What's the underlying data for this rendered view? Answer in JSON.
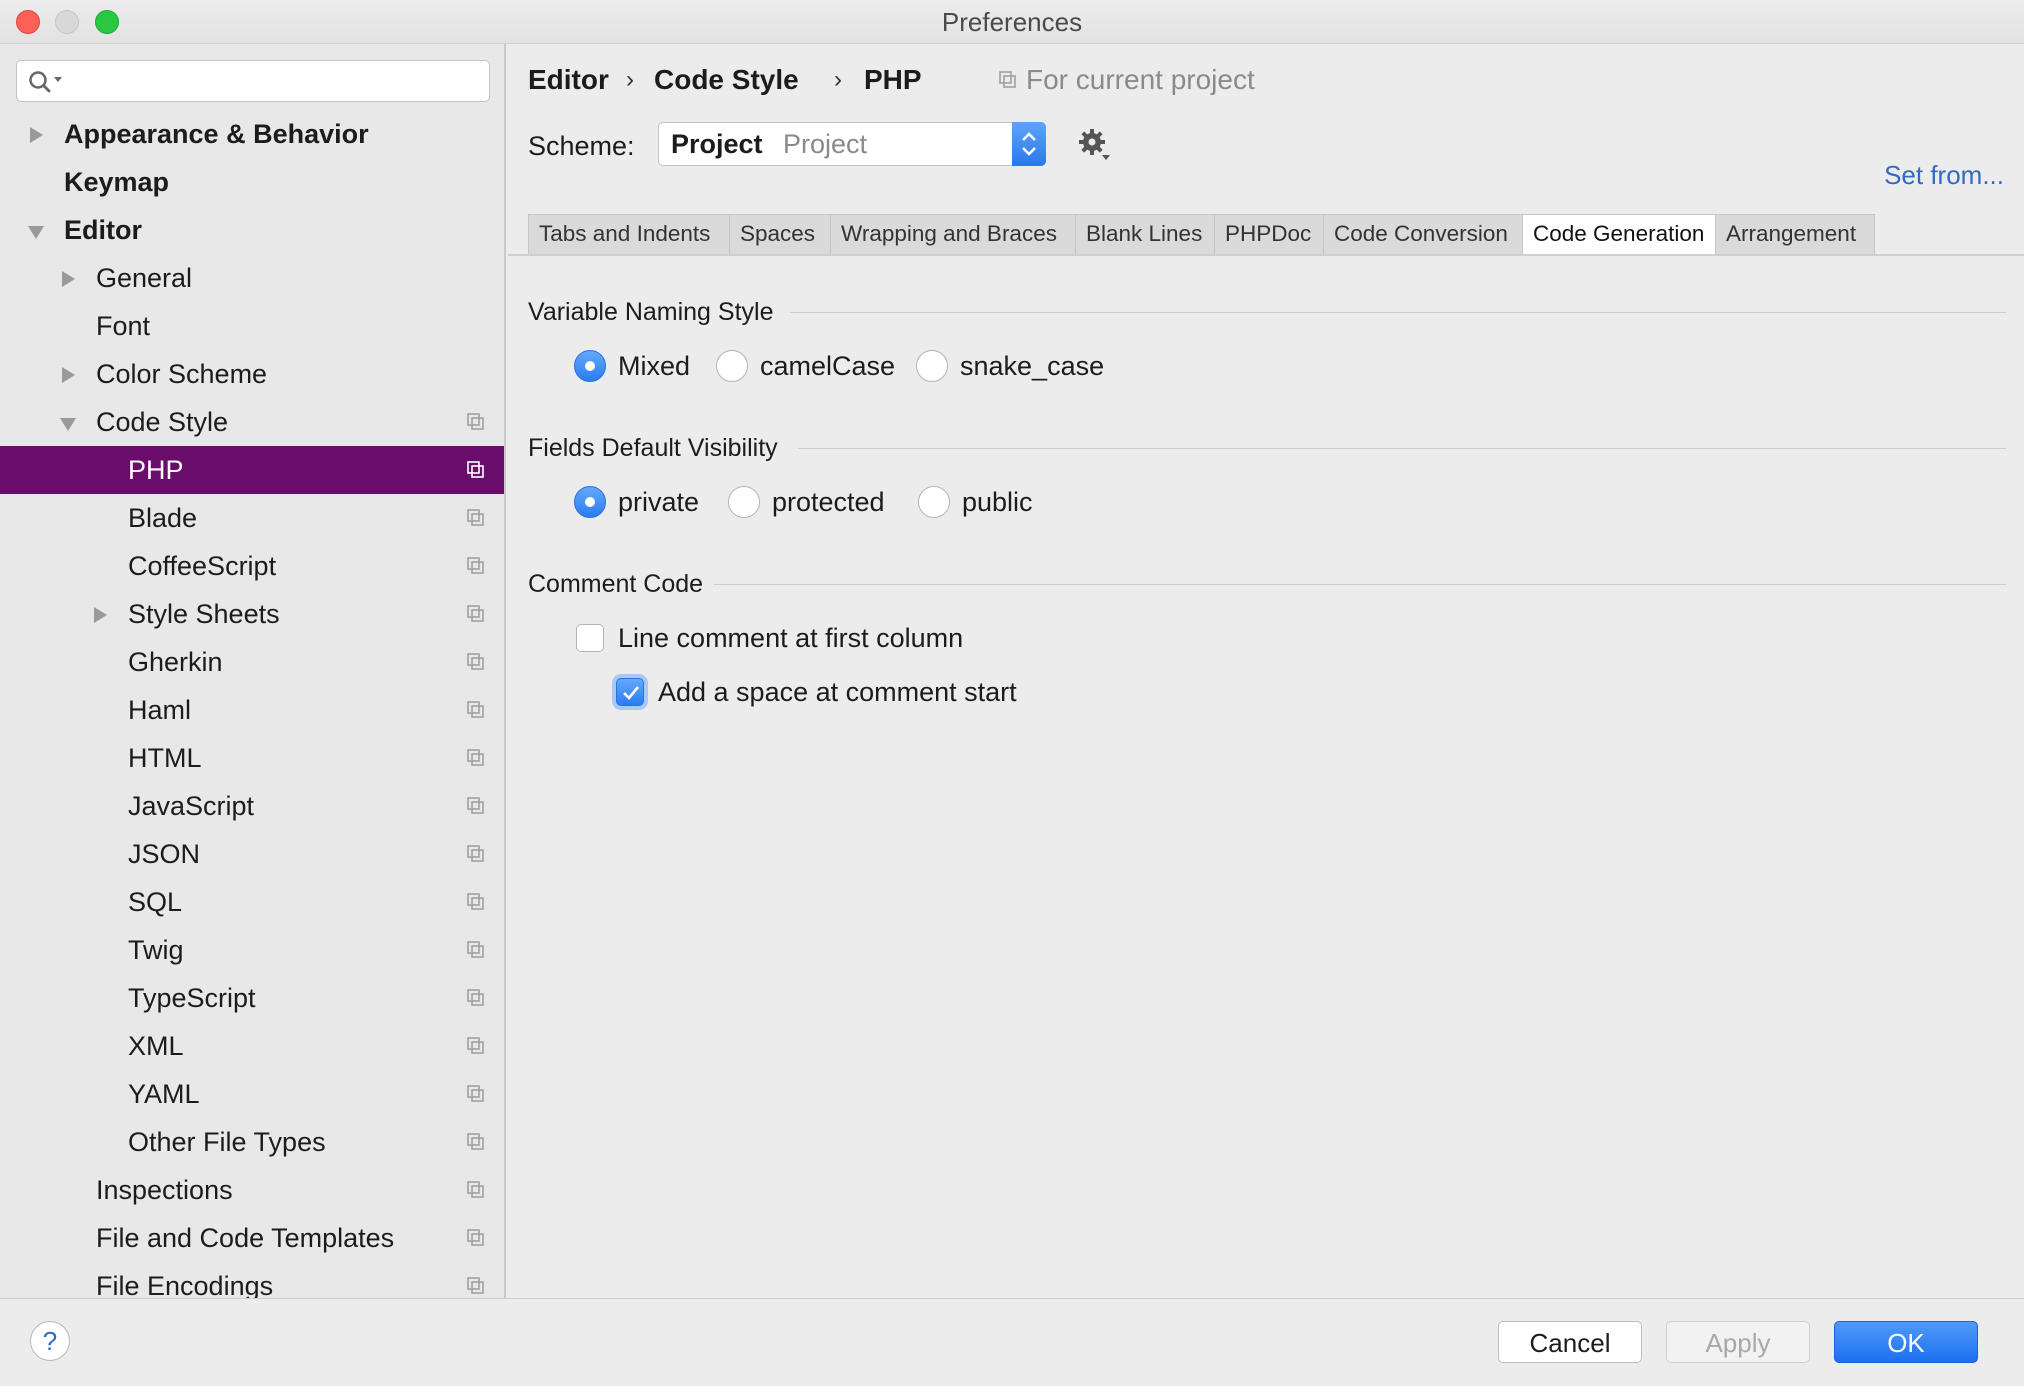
{
  "window": {
    "title": "Preferences"
  },
  "search": {
    "placeholder": "",
    "value": ""
  },
  "sidebar": {
    "items": [
      {
        "label": "Appearance & Behavior"
      },
      {
        "label": "Keymap"
      },
      {
        "label": "Editor"
      },
      {
        "label": "General"
      },
      {
        "label": "Font"
      },
      {
        "label": "Color Scheme"
      },
      {
        "label": "Code Style"
      },
      {
        "label": "PHP"
      },
      {
        "label": "Blade"
      },
      {
        "label": "CoffeeScript"
      },
      {
        "label": "Style Sheets"
      },
      {
        "label": "Gherkin"
      },
      {
        "label": "Haml"
      },
      {
        "label": "HTML"
      },
      {
        "label": "JavaScript"
      },
      {
        "label": "JSON"
      },
      {
        "label": "SQL"
      },
      {
        "label": "Twig"
      },
      {
        "label": "TypeScript"
      },
      {
        "label": "XML"
      },
      {
        "label": "YAML"
      },
      {
        "label": "Other File Types"
      },
      {
        "label": "Inspections"
      },
      {
        "label": "File and Code Templates"
      },
      {
        "label": "File Encodings"
      }
    ],
    "selected": "PHP"
  },
  "breadcrumb": {
    "items": [
      "Editor",
      "Code Style",
      "PHP"
    ],
    "separator": "›",
    "note": "For current project"
  },
  "scheme": {
    "label": "Scheme:",
    "name": "Project",
    "type": "Project",
    "set_from": "Set from..."
  },
  "tabs": [
    {
      "label": "Tabs and Indents"
    },
    {
      "label": "Spaces"
    },
    {
      "label": "Wrapping and Braces"
    },
    {
      "label": "Blank Lines"
    },
    {
      "label": "PHPDoc"
    },
    {
      "label": "Code Conversion"
    },
    {
      "label": "Code Generation",
      "active": true
    },
    {
      "label": "Arrangement"
    }
  ],
  "variable_naming": {
    "title": "Variable Naming Style",
    "options": [
      "Mixed",
      "camelCase",
      "snake_case"
    ],
    "selected": "Mixed"
  },
  "fields_visibility": {
    "title": "Fields Default Visibility",
    "options": [
      "private",
      "protected",
      "public"
    ],
    "selected": "private"
  },
  "comment_code": {
    "title": "Comment Code",
    "line_comment_first_column": {
      "label": "Line comment at first column",
      "checked": false
    },
    "add_space": {
      "label": "Add a space at comment start",
      "checked": true
    }
  },
  "footer": {
    "help": "?",
    "cancel": "Cancel",
    "apply": "Apply",
    "ok": "OK"
  },
  "colors": {
    "selection": "#6a0c6b",
    "accent": "#2d7cf0",
    "link": "#2f6bc2"
  }
}
